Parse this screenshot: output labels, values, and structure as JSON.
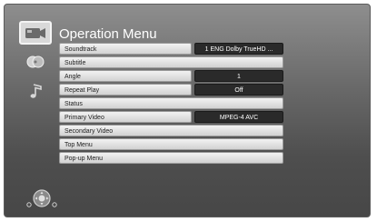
{
  "menu_title": "Operation Menu",
  "side_tabs": [
    {
      "icon": "video-icon",
      "active": true
    },
    {
      "icon": "disc-icon",
      "active": false
    },
    {
      "icon": "music-note-icon",
      "active": false
    }
  ],
  "rows": [
    {
      "label": "Soundtrack",
      "value": "1 ENG Dolby TrueHD  ..."
    },
    {
      "label": "Subtitle",
      "value": ""
    },
    {
      "label": "Angle",
      "value": "1"
    },
    {
      "label": "Repeat Play",
      "value": "Off"
    },
    {
      "label": "Status",
      "value": ""
    },
    {
      "label": "Primary Video",
      "value": "MPEG-4 AVC"
    },
    {
      "label": "Secondary Video",
      "value": ""
    },
    {
      "label": "Top Menu",
      "value": ""
    },
    {
      "label": "Pop-up Menu",
      "value": ""
    }
  ],
  "remote_hint": {
    "icon": "remote-dpad-icon"
  }
}
